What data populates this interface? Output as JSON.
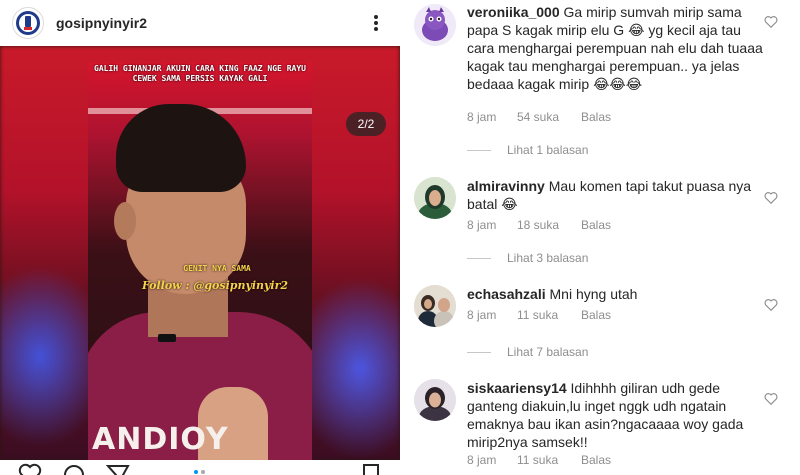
{
  "post": {
    "username": "gosipnyinyir2",
    "counter": "2/2",
    "caption_top": "GALIH GINANJAR AKUIN CARA KING FAAZ NGE RAYU CEWEK SAMA PERSIS KAYAK GALI",
    "caption_mid": "GENIT NYA SAMA",
    "caption_follow": "Follow : @gosipnyinyir2",
    "shirt_text": "ANDIOY"
  },
  "comments": [
    {
      "username": "veroniika_000",
      "text": "Ga mirip sumvah mirip sama papa S kagak mirip elu G 😂 yg kecil aja tau cara menghargai perempuan nah elu dah tuaaa kagak tau menghargai perempuan.. ya jelas bedaaa kagak mirip 😂😂😂",
      "time": "8 jam",
      "likes": "54 suka",
      "reply": "Balas",
      "view_replies": "Lihat 1 balasan"
    },
    {
      "username": "almiravinny",
      "text": "Mau komen tapi takut puasa nya batal 😂",
      "time": "8 jam",
      "likes": "18 suka",
      "reply": "Balas",
      "view_replies": "Lihat 3 balasan"
    },
    {
      "username": "echasahzali",
      "text": "Mni hyng utah",
      "time": "8 jam",
      "likes": "11 suka",
      "reply": "Balas",
      "view_replies": "Lihat 7 balasan"
    },
    {
      "username": "siskaariensy14",
      "text": "Idihhhh giliran udh gede ganteng diakuin,lu inget nggk udh ngatain emaknya bau ikan asin?ngacaaaa woy gada mirip2nya samsek!!",
      "time": "8 jam",
      "likes": "11 suka",
      "reply": "Balas"
    }
  ]
}
